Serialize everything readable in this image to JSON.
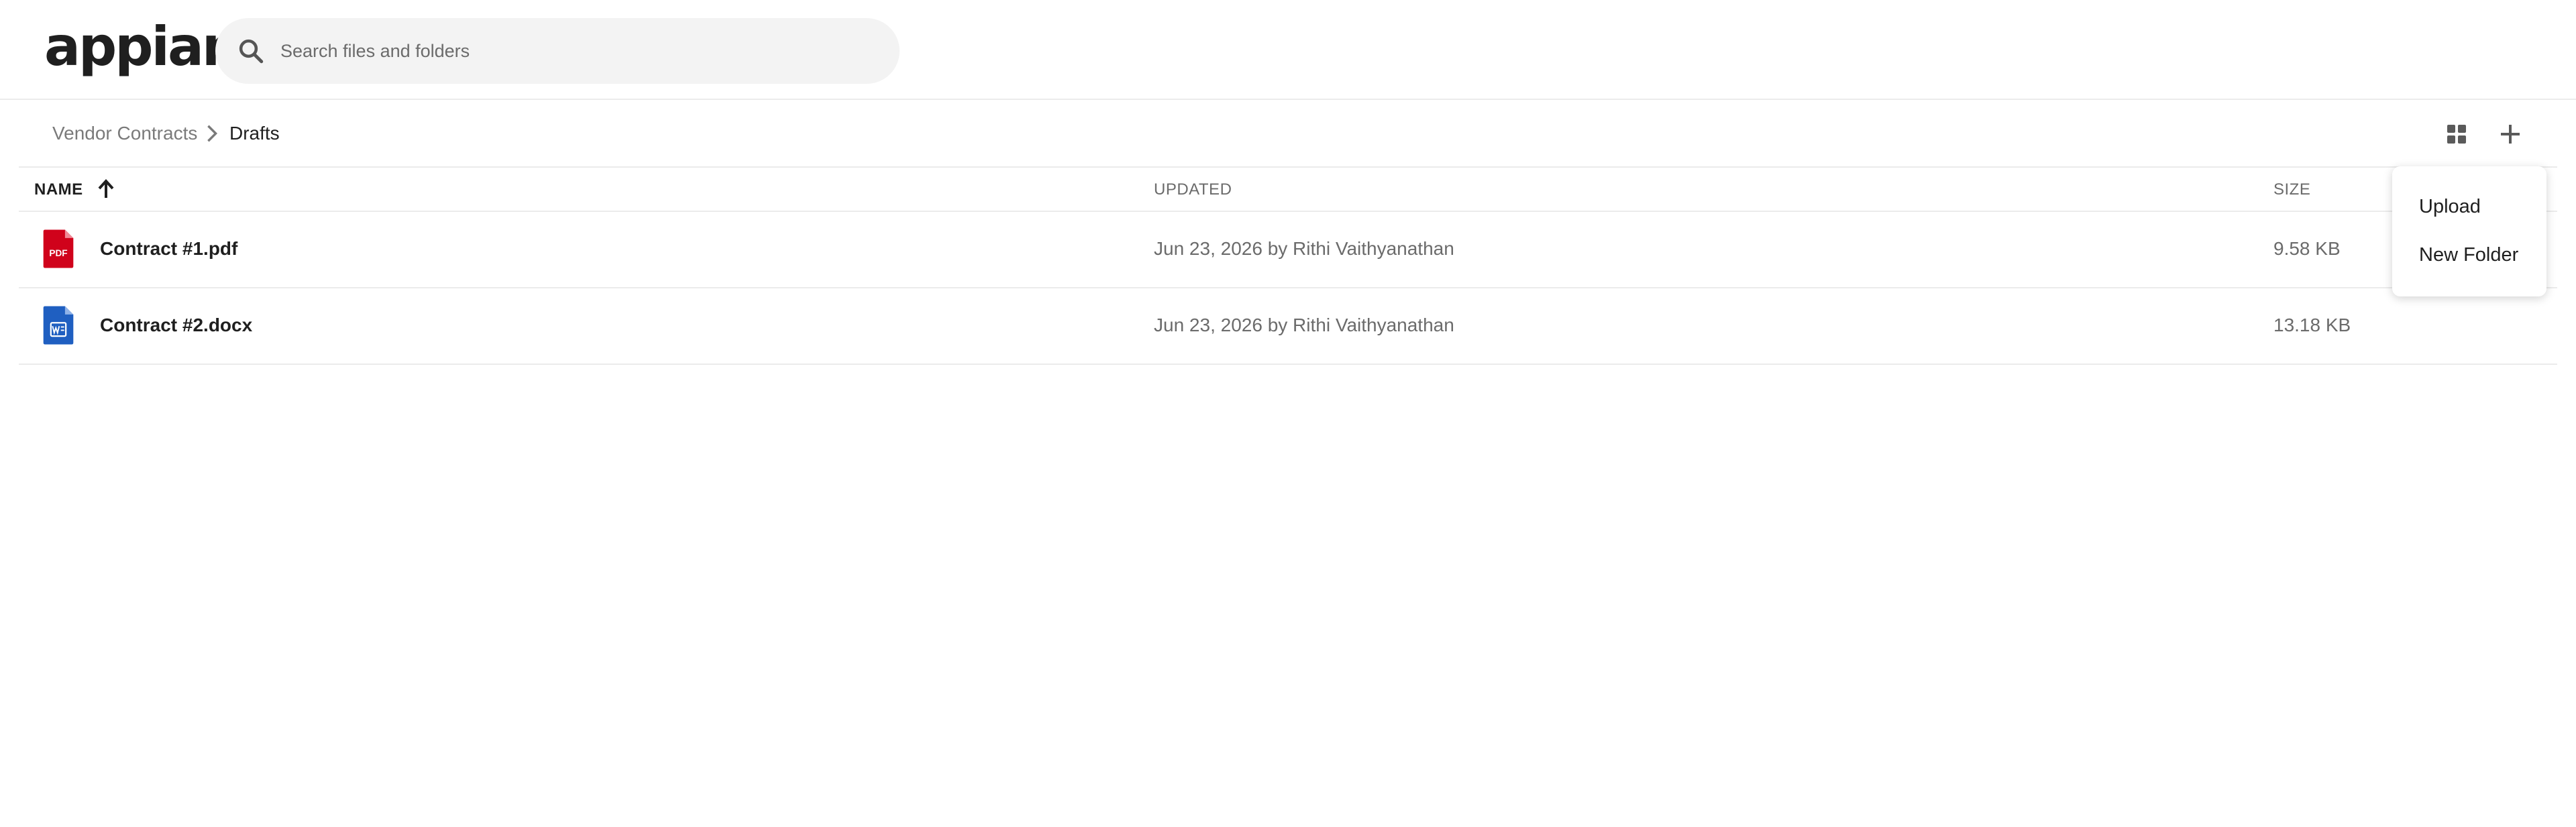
{
  "header": {
    "logo_text": "appian",
    "search": {
      "placeholder": "Search files and folders",
      "value": "",
      "icon": "search-icon"
    }
  },
  "breadcrumb": {
    "items": [
      {
        "label": "Vendor Contracts"
      },
      {
        "label": "Drafts"
      }
    ],
    "separator_icon": "chevron-right-icon"
  },
  "toolbar": {
    "grid_icon": "grid-view-icon",
    "add_icon": "plus-icon"
  },
  "table": {
    "columns": {
      "name": "NAME",
      "updated": "UPDATED",
      "size": "SIZE"
    },
    "sort": {
      "column": "name",
      "direction": "ascending",
      "icon": "arrow-up-icon"
    },
    "rows": [
      {
        "name": "Contract #1.pdf",
        "updated": "Jun 23, 2026 by Rithi Vaithyanathan",
        "size": "9.58 KB",
        "icon": "pdf-file-icon",
        "icon_text": "PDF",
        "icon_color": "#d0021b"
      },
      {
        "name": "Contract #2.docx",
        "updated": "Jun 23, 2026 by Rithi Vaithyanathan",
        "size": "13.18 KB",
        "icon": "word-file-icon",
        "icon_color": "#1f5fc1"
      }
    ]
  },
  "add_menu": {
    "items": [
      {
        "label": "Upload"
      },
      {
        "label": "New Folder"
      }
    ]
  }
}
